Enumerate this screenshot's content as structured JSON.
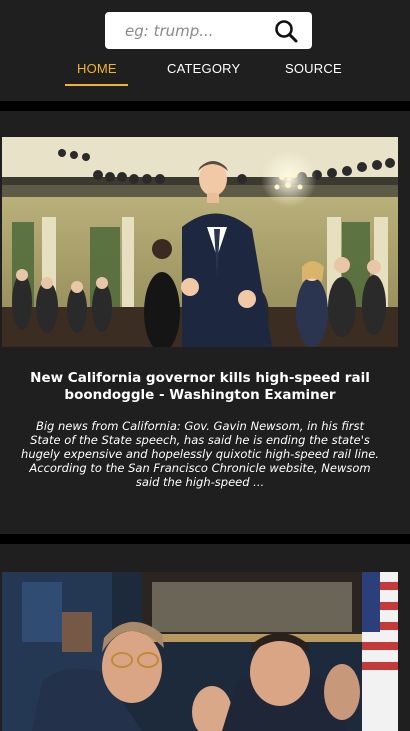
{
  "search": {
    "placeholder": "eg: trump..."
  },
  "nav": {
    "items": [
      {
        "label": "HOME",
        "active": true
      },
      {
        "label": "CATEGORY",
        "active": false
      },
      {
        "label": "SOURCE",
        "active": false
      }
    ]
  },
  "articles": [
    {
      "title": "New California governor kills high-speed rail boondoggle - Washington Examiner",
      "description": "Big news from California: Gov. Gavin Newsom, in his first State of the State speech, has said he is ending the state's hugely expensive and hopelessly quixotic high-speed rail line. According to the San Francisco Chronicle website, Newsom said the high-speed ..."
    },
    {
      "title": "",
      "description": ""
    }
  ],
  "colors": {
    "accent": "#f3b523",
    "background": "#1f1f1f",
    "divider": "#000000",
    "text": "#ffffff"
  }
}
